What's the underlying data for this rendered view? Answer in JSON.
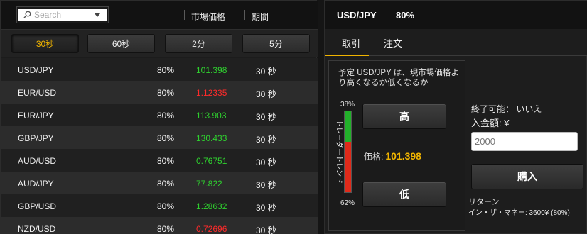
{
  "search": {
    "placeholder": "Search"
  },
  "list_header": {
    "market_price": "市場価格",
    "period": "期間"
  },
  "durations": [
    {
      "label": "30秒",
      "active": true
    },
    {
      "label": "60秒",
      "active": false
    },
    {
      "label": "2分",
      "active": false
    },
    {
      "label": "5分",
      "active": false
    }
  ],
  "rows": [
    {
      "pair": "USD/JPY",
      "payout": "80%",
      "price": "101.398",
      "price_color": "#2fd12f",
      "period": "30 秒"
    },
    {
      "pair": "EUR/USD",
      "payout": "80%",
      "price": "1.12335",
      "price_color": "#ff2a2a",
      "period": "30 秒"
    },
    {
      "pair": "EUR/JPY",
      "payout": "80%",
      "price": "113.903",
      "price_color": "#2fd12f",
      "period": "30 秒"
    },
    {
      "pair": "GBP/JPY",
      "payout": "80%",
      "price": "130.433",
      "price_color": "#2fd12f",
      "period": "30 秒"
    },
    {
      "pair": "AUD/USD",
      "payout": "80%",
      "price": "0.76751",
      "price_color": "#2fd12f",
      "period": "30 秒"
    },
    {
      "pair": "AUD/JPY",
      "payout": "80%",
      "price": "77.822",
      "price_color": "#2fd12f",
      "period": "30 秒"
    },
    {
      "pair": "GBP/USD",
      "payout": "80%",
      "price": "1.28632",
      "price_color": "#2fd12f",
      "period": "30 秒"
    },
    {
      "pair": "NZD/USD",
      "payout": "80%",
      "price": "0.72696",
      "price_color": "#ff2a2a",
      "period": "30 秒"
    }
  ],
  "panel": {
    "pair": "USD/JPY",
    "payout": "80%",
    "tabs": {
      "trade": "取引",
      "order": "注文"
    },
    "question": "予定 USD/JPY は、現市場価格より高くなるか低くなるか",
    "trend": {
      "up_pct": "38%",
      "down_pct": "62%",
      "up_fraction": 0.38,
      "label": "トレーダートレンド"
    },
    "high_label": "高",
    "low_label": "低",
    "price_label": "価格:",
    "price_value": "101.398",
    "closable": "終了可能： いいえ",
    "amount_label": "入金額: ¥",
    "amount_value": "2000",
    "buy_label": "購入",
    "return_label": "リターン",
    "return_value": "イン・ザ・マネー: 3600¥ (80%)"
  },
  "colors": {
    "accent": "#f0b400",
    "up": "#2fd12f",
    "down": "#ff2a2a"
  }
}
